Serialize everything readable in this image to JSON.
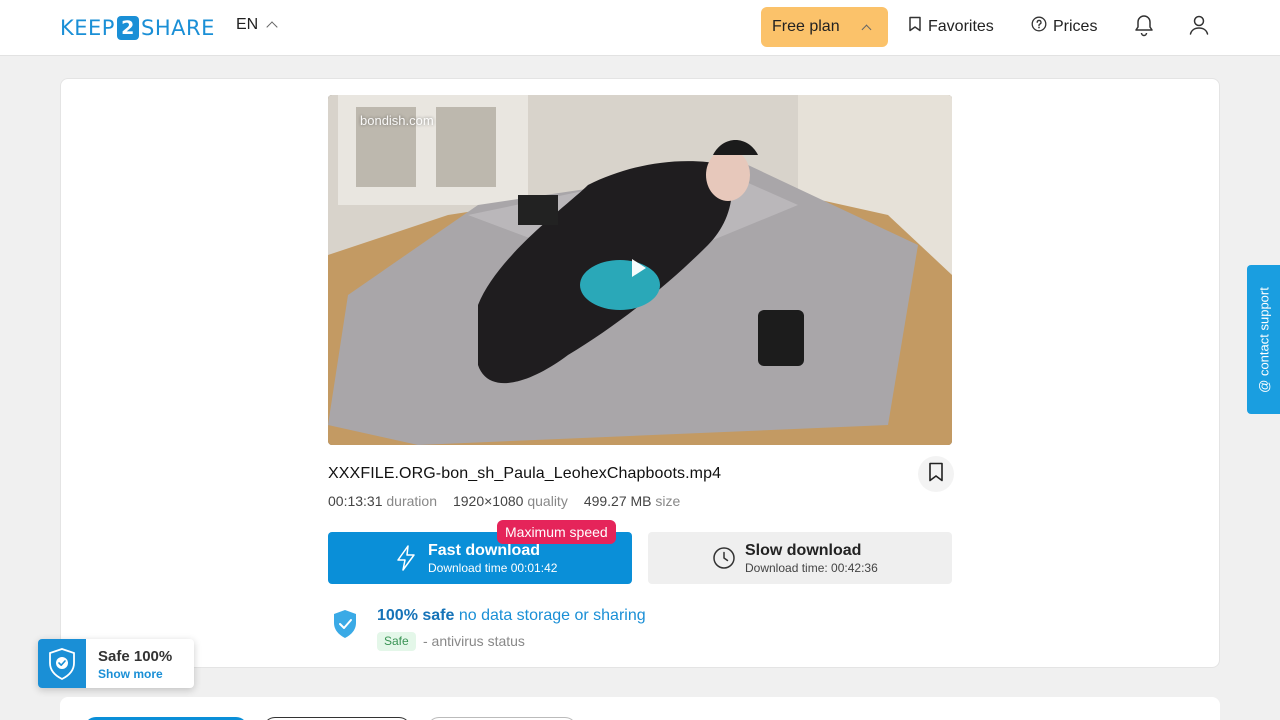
{
  "header": {
    "logo_left": "KEEP",
    "logo_mid": "2",
    "logo_right": "SHARE",
    "language": "EN",
    "plan_label": "Free plan",
    "favorites_label": "Favorites",
    "prices_label": "Prices"
  },
  "file": {
    "watermark": "bondish.com",
    "name": "XXXFILE.ORG-bon_sh_Paula_LeohexChapboots.mp4",
    "duration_value": "00:13:31",
    "duration_label": "duration",
    "quality_value": "1920×1080",
    "quality_label": "quality",
    "size_value": "499.27 MB",
    "size_label": "size"
  },
  "downloads": {
    "fast_title": "Fast download",
    "fast_sub": "Download time 00:01:42",
    "max_speed_badge": "Maximum speed",
    "slow_title": "Slow download",
    "slow_sub": "Download time: 00:42:36"
  },
  "safety": {
    "title_bold": "100% safe",
    "title_rest": " no data storage or sharing",
    "badge": "Safe",
    "status": "- antivirus status"
  },
  "contact_support": "@ contact support",
  "safe_widget": {
    "title": "Safe 100%",
    "link": "Show more"
  },
  "colors": {
    "brand_blue": "#0a8fd8",
    "plan_yellow": "#fbc26a",
    "badge_red": "#e5245a"
  }
}
